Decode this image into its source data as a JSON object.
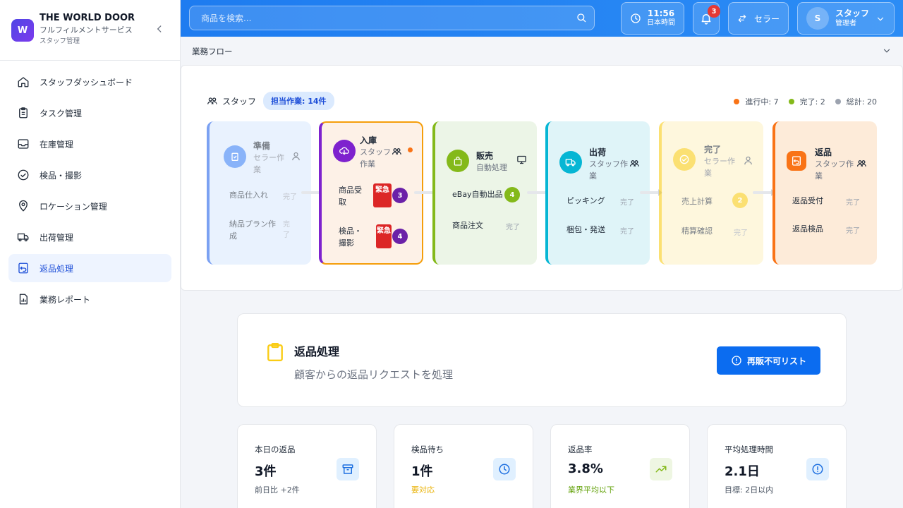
{
  "brand": {
    "logo_letter": "W",
    "name": "THE WORLD DOOR",
    "subtitle": "フルフィルメントサービス",
    "section": "スタッフ管理"
  },
  "nav": {
    "items": [
      {
        "label": "スタッフダッシュボード",
        "icon": "home-icon"
      },
      {
        "label": "タスク管理",
        "icon": "clipboard-icon"
      },
      {
        "label": "在庫管理",
        "icon": "inbox-icon"
      },
      {
        "label": "検品・撮影",
        "icon": "check-circle-icon"
      },
      {
        "label": "ロケーション管理",
        "icon": "location-pin-icon"
      },
      {
        "label": "出荷管理",
        "icon": "truck-icon"
      },
      {
        "label": "返品処理",
        "icon": "return-icon",
        "active": true
      },
      {
        "label": "業務レポート",
        "icon": "report-icon"
      }
    ]
  },
  "header": {
    "search_placeholder": "商品を検索...",
    "clock": {
      "time": "11:56",
      "zone": "日本時間"
    },
    "notifications": "3",
    "role_switch": "セラー",
    "user": {
      "initial": "S",
      "name": "スタッフ",
      "role": "管理者"
    }
  },
  "flow": {
    "title": "業務フロー",
    "group": "スタッフ",
    "assigned": "担当作業: 14件",
    "legend": {
      "in_progress": "進行中: 7",
      "done": "完了: 2",
      "total": "総計: 20"
    },
    "stages": [
      {
        "title": "準備",
        "sub": "セラー作業",
        "tasks": [
          {
            "name": "商品仕入れ",
            "status": "完了"
          },
          {
            "name": "納品プラン作成",
            "status": "完了"
          }
        ]
      },
      {
        "title": "入庫",
        "sub": "スタッフ作業",
        "tasks": [
          {
            "name": "商品受取",
            "urgent": "緊急",
            "count": "3"
          },
          {
            "name": "検品・撮影",
            "urgent": "緊急",
            "count": "4"
          }
        ]
      },
      {
        "title": "販売",
        "sub": "自動処理",
        "tasks": [
          {
            "name": "eBay自動出品",
            "count": "4"
          },
          {
            "name": "商品注文",
            "status": "完了"
          }
        ]
      },
      {
        "title": "出荷",
        "sub": "スタッフ作業",
        "tasks": [
          {
            "name": "ピッキング",
            "status": "完了"
          },
          {
            "name": "梱包・発送",
            "status": "完了"
          }
        ]
      },
      {
        "title": "完了",
        "sub": "セラー作業",
        "tasks": [
          {
            "name": "売上計算",
            "count": "2"
          },
          {
            "name": "精算確認",
            "status": "完了"
          }
        ]
      },
      {
        "title": "返品",
        "sub": "スタッフ作業",
        "tasks": [
          {
            "name": "返品受付",
            "status": "完了"
          },
          {
            "name": "返品検品",
            "status": "完了"
          }
        ]
      }
    ]
  },
  "returns": {
    "title": "返品処理",
    "subtitle": "顧客からの返品リクエストを処理",
    "button": "再販不可リスト"
  },
  "stats": [
    {
      "label": "本日の返品",
      "value": "3件",
      "note": "前日比 +2件",
      "icon": "archive-box-icon"
    },
    {
      "label": "検品待ち",
      "value": "1件",
      "note": "要対応",
      "icon": "clock-icon"
    },
    {
      "label": "返品率",
      "value": "3.8%",
      "note": "業界平均以下",
      "icon": "trending-up-icon"
    },
    {
      "label": "平均処理時間",
      "value": "2.1日",
      "note": "目標: 2日以内",
      "icon": "alert-circle-icon"
    }
  ],
  "colors": {
    "accent": "#1e7cf0",
    "in_progress": "#f97316",
    "done": "#84b91a",
    "total": "#9ca3af",
    "urgent": "#dc2626"
  }
}
